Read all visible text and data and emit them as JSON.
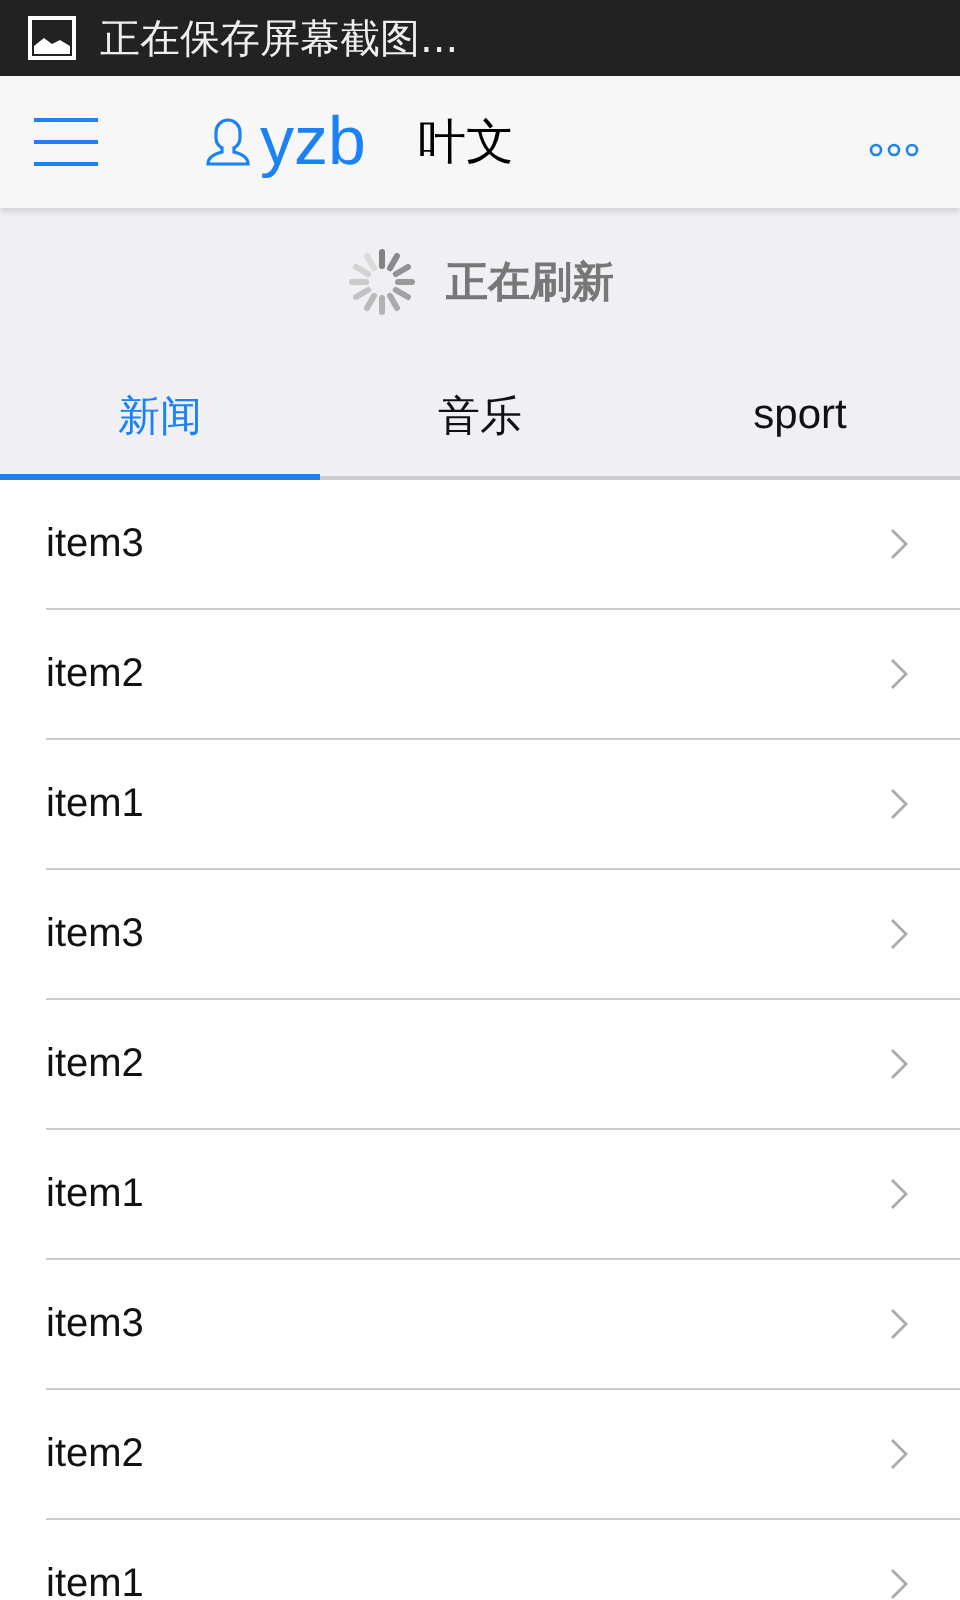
{
  "status_bar": {
    "notification": "正在保存屏幕截图..."
  },
  "nav_bar": {
    "brand": "yzb",
    "title": "叶文"
  },
  "refresh": {
    "label": "正在刷新"
  },
  "tabs": [
    {
      "label": "新闻",
      "selected": true
    },
    {
      "label": "音乐",
      "selected": false
    },
    {
      "label": "sport",
      "selected": false
    }
  ],
  "list": [
    {
      "label": "item3"
    },
    {
      "label": "item2"
    },
    {
      "label": "item1"
    },
    {
      "label": "item3"
    },
    {
      "label": "item2"
    },
    {
      "label": "item1"
    },
    {
      "label": "item3"
    },
    {
      "label": "item2"
    },
    {
      "label": "item1"
    }
  ]
}
